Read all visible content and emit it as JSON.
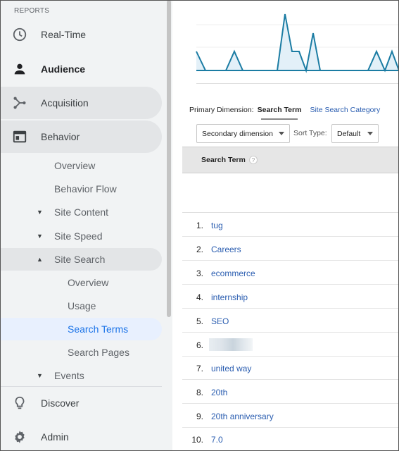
{
  "sidebar": {
    "reports_header": "REPORTS",
    "top_items": [
      {
        "label": "Real-Time",
        "icon": "clock-icon"
      },
      {
        "label": "Audience",
        "icon": "person-icon"
      },
      {
        "label": "Acquisition",
        "icon": "acquisition-icon"
      },
      {
        "label": "Behavior",
        "icon": "behavior-icon"
      }
    ],
    "behavior_children": [
      {
        "label": "Overview"
      },
      {
        "label": "Behavior Flow"
      },
      {
        "label": "Site Content",
        "expander": "collapsed"
      },
      {
        "label": "Site Speed",
        "expander": "collapsed"
      },
      {
        "label": "Site Search",
        "expander": "expanded"
      },
      {
        "label": "Overview"
      },
      {
        "label": "Usage"
      },
      {
        "label": "Search Terms",
        "selected": true
      },
      {
        "label": "Search Pages"
      },
      {
        "label": "Events",
        "expander": "collapsed"
      }
    ],
    "bottom_items": [
      {
        "label": "Discover",
        "icon": "lightbulb-icon"
      },
      {
        "label": "Admin",
        "icon": "gear-icon"
      }
    ]
  },
  "explorer": {
    "primary_dimension_label": "Primary Dimension:",
    "primary_dimension_current": "Search Term",
    "primary_dimension_alt": "Site Search Category",
    "secondary_dimension": "Secondary dimension",
    "sort_type_label": "Sort Type:",
    "sort_type_value": "Default"
  },
  "table": {
    "column_header": "Search Term",
    "help_icon": "?",
    "rows": [
      {
        "num": "1.",
        "term": "tug"
      },
      {
        "num": "2.",
        "term": "Careers"
      },
      {
        "num": "3.",
        "term": "ecommerce"
      },
      {
        "num": "4.",
        "term": "internship"
      },
      {
        "num": "5.",
        "term": "SEO"
      },
      {
        "num": "6.",
        "term": "",
        "redacted": true
      },
      {
        "num": "7.",
        "term": "united way"
      },
      {
        "num": "8.",
        "term": "20th"
      },
      {
        "num": "9.",
        "term": "20th anniversary"
      },
      {
        "num": "10.",
        "term": "7.0"
      }
    ]
  },
  "colors": {
    "line": "#1b7ca3",
    "fill": "#e3f0f8",
    "link": "#2a5db0",
    "selected_blue": "#1a73e8"
  }
}
